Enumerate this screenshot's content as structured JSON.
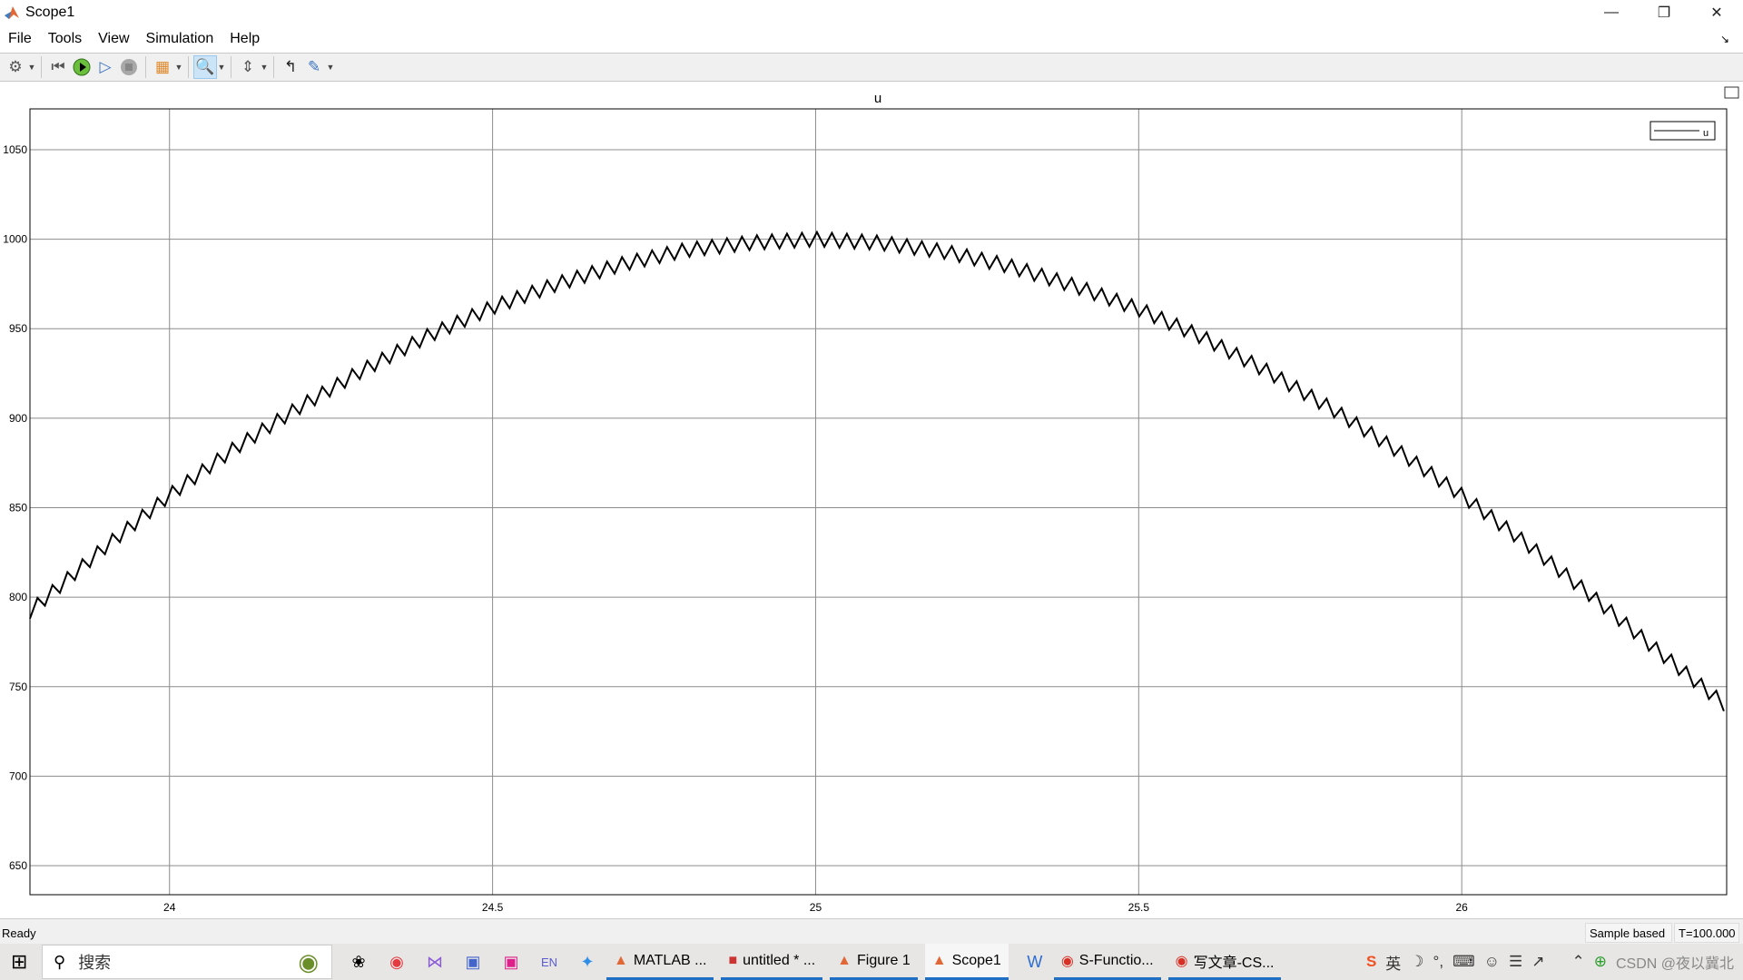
{
  "window": {
    "title": "Scope1",
    "controls": [
      "minimize",
      "restore",
      "close"
    ]
  },
  "menu": [
    "File",
    "Tools",
    "View",
    "Simulation",
    "Help"
  ],
  "toolbar": {
    "icons": [
      "gear-icon",
      "rewind-icon",
      "run-icon",
      "step-forward-icon",
      "stop-icon",
      "signal-hierarchy-icon",
      "zoom-in-icon",
      "scale-axes-icon",
      "highlight-icon",
      "measure-icon"
    ],
    "active": "zoom-in-icon"
  },
  "status": {
    "text": "Ready",
    "mode": "Sample based",
    "time": "T=100.000"
  },
  "taskbar": {
    "search_placeholder": "搜索",
    "apps": [
      {
        "label": "MATLAB ..."
      },
      {
        "label": "untitled * ..."
      },
      {
        "label": "Figure 1"
      },
      {
        "label": "Scope1",
        "active": true
      },
      {
        "label": "S-Functio..."
      },
      {
        "label": "写文章-CS..."
      }
    ],
    "tray": [
      "英"
    ],
    "watermark": "CSDN @夜以冀北"
  },
  "chart_data": {
    "type": "line",
    "title": "u",
    "legend": [
      "u"
    ],
    "legend_placement": "top-right",
    "grid": true,
    "xlim": [
      23.784,
      26.41
    ],
    "ylim": [
      633.8,
      1072.8
    ],
    "xticks": [
      "24",
      "24.5",
      "25",
      "25.5",
      "26"
    ],
    "yticks": [
      "650",
      "700",
      "750",
      "800",
      "850",
      "900",
      "950",
      "1000",
      "1050"
    ],
    "line_color": "#000000",
    "trend": {
      "x": [
        23.8,
        23.9,
        24.0,
        24.1,
        24.2,
        24.3,
        24.4,
        24.5,
        24.6,
        24.7,
        24.8,
        24.9,
        25.0,
        25.1,
        25.2,
        25.3,
        25.4,
        25.5,
        25.6,
        25.7,
        25.8,
        25.9,
        26.0,
        26.1,
        26.2,
        26.3,
        26.4
      ],
      "y": [
        797,
        828,
        857,
        883,
        906,
        927,
        946,
        962,
        975,
        986,
        994,
        998,
        1000,
        998,
        993,
        985,
        974,
        961,
        945,
        926,
        905,
        882,
        857,
        830,
        801,
        771,
        742
      ]
    },
    "ripple_period": 0.0232,
    "ripple_peak_to_peak": 8
  }
}
